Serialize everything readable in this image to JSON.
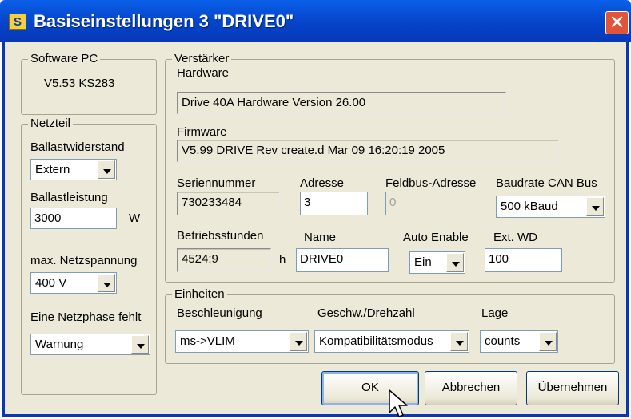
{
  "window": {
    "title": "Basiseinstellungen 3 \"DRIVE0\"",
    "app_icon_letter": "S"
  },
  "software_pc": {
    "group_title": "Software PC",
    "version": "V5.53 KS283"
  },
  "netzteil": {
    "group_title": "Netzteil",
    "ballastwiderstand_label": "Ballastwiderstand",
    "ballastwiderstand_value": "Extern",
    "ballastleistung_label": "Ballastleistung",
    "ballastleistung_value": "3000",
    "ballastleistung_unit": "W",
    "netzspannung_label": "max. Netzspannung",
    "netzspannung_value": "400 V",
    "netzphase_label": "Eine Netzphase fehlt",
    "netzphase_value": "Warnung"
  },
  "verstaerker": {
    "group_title": "Verstärker",
    "hardware_label": "Hardware",
    "hardware_value": "Drive 40A Hardware Version 26.00",
    "firmware_label": "Firmware",
    "firmware_value": "V5.99 DRIVE Rev create.d Mar 09 16:20:19 2005",
    "seriennummer_label": "Seriennummer",
    "seriennummer_value": "730233484",
    "adresse_label": "Adresse",
    "adresse_value": "3",
    "feldbus_label": "Feldbus-Adresse",
    "feldbus_value": "0",
    "baudrate_label": "Baudrate CAN Bus",
    "baudrate_value": "500 kBaud",
    "betriebsstunden_label": "Betriebsstunden",
    "betriebsstunden_value": "4524:9",
    "betriebsstunden_unit": "h",
    "name_label": "Name",
    "name_value": "DRIVE0",
    "auto_enable_label": "Auto Enable",
    "auto_enable_value": "Ein",
    "ext_wd_label": "Ext. WD",
    "ext_wd_value": "100"
  },
  "einheiten": {
    "group_title": "Einheiten",
    "beschleunigung_label": "Beschleunigung",
    "beschleunigung_value": "ms->VLIM",
    "geschw_label": "Geschw./Drehzahl",
    "geschw_value": "Kompatibilitätsmodus",
    "lage_label": "Lage",
    "lage_value": "counts"
  },
  "buttons": {
    "ok": "OK",
    "abbrechen": "Abbrechen",
    "uebernehmen": "Übernehmen"
  }
}
